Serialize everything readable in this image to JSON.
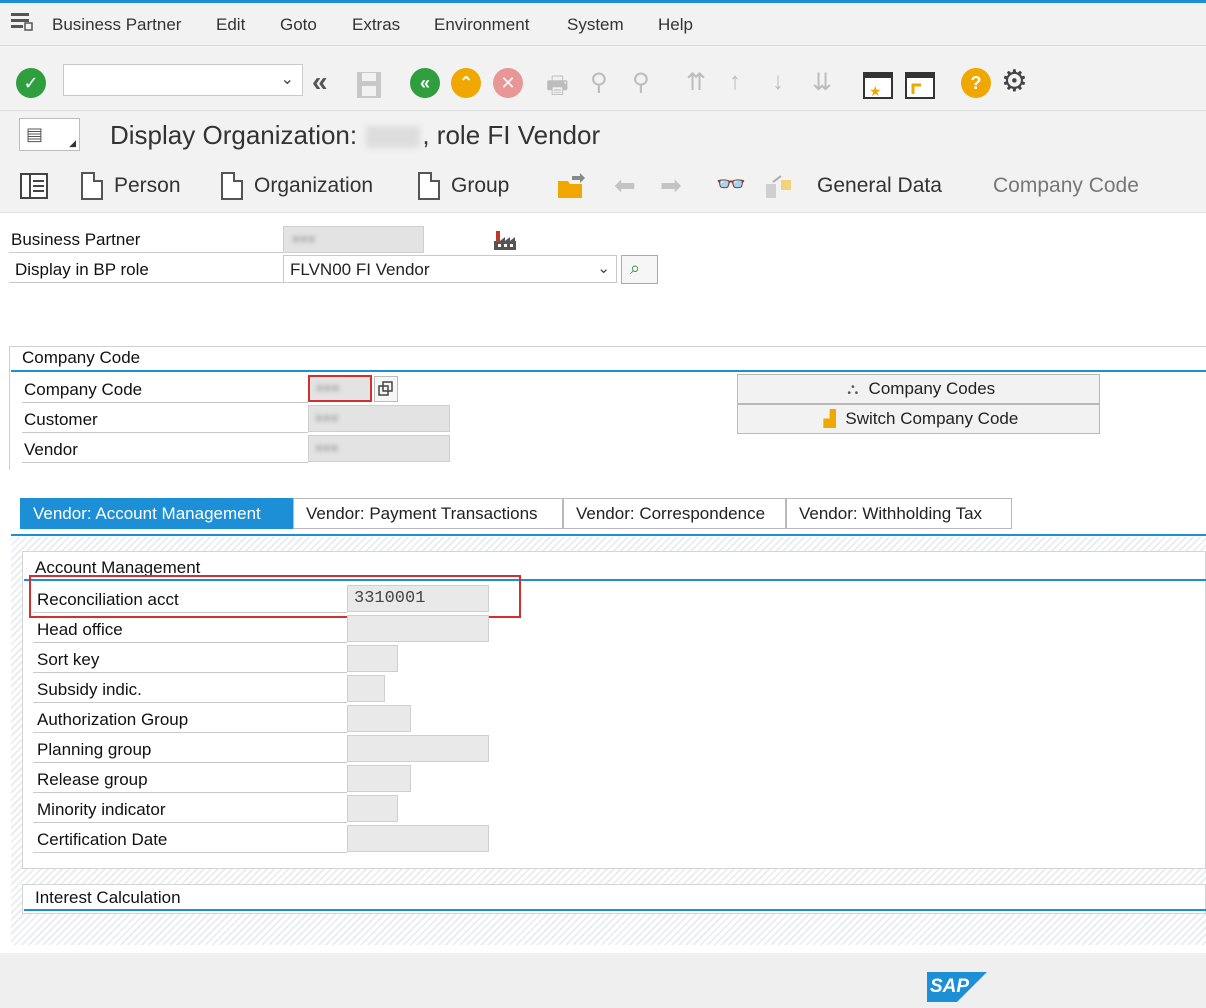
{
  "menubar": {
    "items": [
      "Business Partner",
      "Edit",
      "Goto",
      "Extras",
      "Environment",
      "System",
      "Help"
    ]
  },
  "toolbar": {
    "command_field_value": ""
  },
  "title": {
    "prefix": "Display Organization:",
    "suffix": ", role FI Vendor"
  },
  "app_toolbar": {
    "person": "Person",
    "organization": "Organization",
    "group": "Group",
    "general_data": "General Data",
    "company_code": "Company Code"
  },
  "header_fields": {
    "business_partner_label": "Business Partner",
    "bp_role_label": "Display in BP role",
    "bp_role_value": "FLVN00 FI Vendor"
  },
  "company_code_section": {
    "title": "Company Code",
    "company_code_label": "Company Code",
    "customer_label": "Customer",
    "vendor_label": "Vendor",
    "company_codes_button": "Company Codes",
    "switch_company_code_button": "Switch Company Code"
  },
  "tabs": [
    {
      "label": "Vendor: Account Management",
      "active": true
    },
    {
      "label": "Vendor: Payment Transactions",
      "active": false
    },
    {
      "label": "Vendor: Correspondence",
      "active": false
    },
    {
      "label": "Vendor: Withholding Tax",
      "active": false
    }
  ],
  "account_management": {
    "title": "Account Management",
    "fields": [
      {
        "label": "Reconciliation acct",
        "value": "3310001"
      },
      {
        "label": "Head office",
        "value": ""
      },
      {
        "label": "Sort key",
        "value": ""
      },
      {
        "label": "Subsidy indic.",
        "value": ""
      },
      {
        "label": "Authorization Group",
        "value": ""
      },
      {
        "label": "Planning group",
        "value": ""
      },
      {
        "label": "Release group",
        "value": ""
      },
      {
        "label": "Minority indicator",
        "value": ""
      },
      {
        "label": "Certification Date",
        "value": ""
      }
    ]
  },
  "interest_section": {
    "title": "Interest Calculation"
  },
  "footer": {
    "logo_text": "SAP"
  },
  "colors": {
    "accent": "#1d8fd6",
    "highlight_box": "#d32f2f",
    "ok_green": "#2e9e3e",
    "warn_yellow": "#f0a800",
    "cancel_red": "#e24c4c"
  }
}
